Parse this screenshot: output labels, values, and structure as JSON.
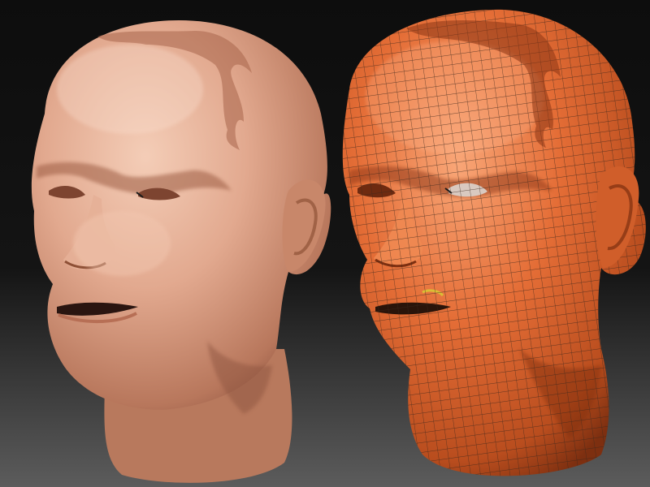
{
  "scene": {
    "background_top": "#0d0d0d",
    "background_bottom": "#5c5c5c",
    "left_model": {
      "name": "sculpted-head-smooth",
      "shading": "smooth",
      "skin_base": "#d89a80",
      "skin_light": "#f1c6ae",
      "skin_shadow": "#9c5e46"
    },
    "right_model": {
      "name": "sculpted-head-wireframe",
      "shading": "wireframe-overlay",
      "skin_base": "#e06a33",
      "skin_light": "#f7a071",
      "skin_shadow": "#8a3414",
      "wire_color": "#3a2a22"
    }
  }
}
